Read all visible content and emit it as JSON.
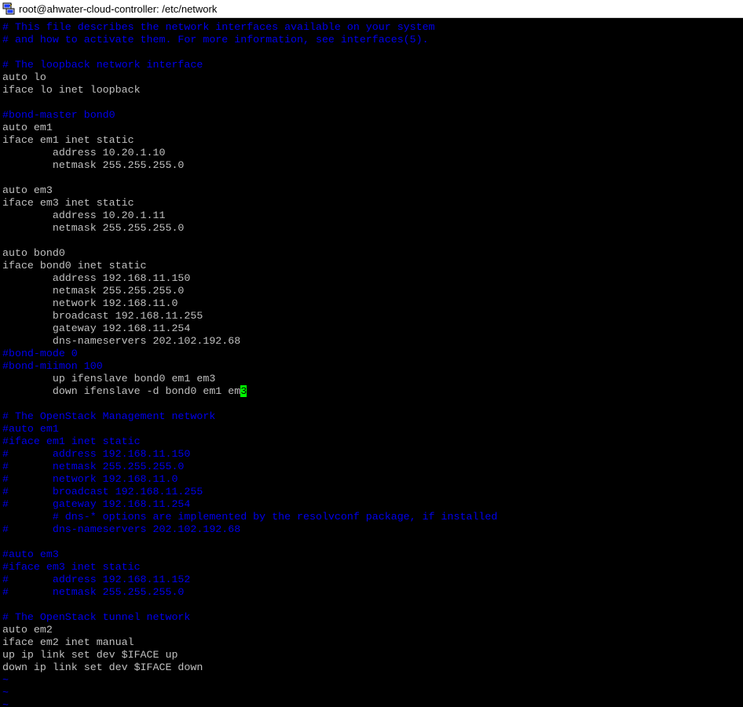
{
  "window": {
    "title": "root@ahwater-cloud-controller: /etc/network"
  },
  "file": {
    "lines": [
      {
        "type": "comment",
        "text": "# This file describes the network interfaces available on your system"
      },
      {
        "type": "comment",
        "text": "# and how to activate them. For more information, see interfaces(5)."
      },
      {
        "type": "blank",
        "text": ""
      },
      {
        "type": "comment",
        "text": "# The loopback network interface"
      },
      {
        "type": "code",
        "text": "auto lo"
      },
      {
        "type": "code",
        "text": "iface lo inet loopback"
      },
      {
        "type": "blank",
        "text": ""
      },
      {
        "type": "comment",
        "text": "#bond-master bond0"
      },
      {
        "type": "code",
        "text": "auto em1"
      },
      {
        "type": "code",
        "text": "iface em1 inet static"
      },
      {
        "type": "code",
        "text": "        address 10.20.1.10"
      },
      {
        "type": "code",
        "text": "        netmask 255.255.255.0"
      },
      {
        "type": "blank",
        "text": ""
      },
      {
        "type": "code",
        "text": "auto em3"
      },
      {
        "type": "code",
        "text": "iface em3 inet static"
      },
      {
        "type": "code",
        "text": "        address 10.20.1.11"
      },
      {
        "type": "code",
        "text": "        netmask 255.255.255.0"
      },
      {
        "type": "blank",
        "text": ""
      },
      {
        "type": "code",
        "text": "auto bond0"
      },
      {
        "type": "code",
        "text": "iface bond0 inet static"
      },
      {
        "type": "code",
        "text": "        address 192.168.11.150"
      },
      {
        "type": "code",
        "text": "        netmask 255.255.255.0"
      },
      {
        "type": "code",
        "text": "        network 192.168.11.0"
      },
      {
        "type": "code",
        "text": "        broadcast 192.168.11.255"
      },
      {
        "type": "code",
        "text": "        gateway 192.168.11.254"
      },
      {
        "type": "code",
        "text": "        dns-nameservers 202.102.192.68"
      },
      {
        "type": "comment",
        "text": "#bond-mode 0"
      },
      {
        "type": "comment",
        "text": "#bond-miimon 100"
      },
      {
        "type": "code",
        "text": "        up ifenslave bond0 em1 em3"
      },
      {
        "type": "cursor",
        "text": "        down ifenslave -d bond0 em1 em",
        "cursor_char": "3"
      },
      {
        "type": "blank",
        "text": ""
      },
      {
        "type": "comment",
        "text": "# The OpenStack Management network"
      },
      {
        "type": "comment",
        "text": "#auto em1"
      },
      {
        "type": "comment",
        "text": "#iface em1 inet static"
      },
      {
        "type": "comment",
        "text": "#       address 192.168.11.150"
      },
      {
        "type": "comment",
        "text": "#       netmask 255.255.255.0"
      },
      {
        "type": "comment",
        "text": "#       network 192.168.11.0"
      },
      {
        "type": "comment",
        "text": "#       broadcast 192.168.11.255"
      },
      {
        "type": "comment",
        "text": "#       gateway 192.168.11.254"
      },
      {
        "type": "comment",
        "text": "        # dns-* options are implemented by the resolvconf package, if installed"
      },
      {
        "type": "comment",
        "text": "#       dns-nameservers 202.102.192.68"
      },
      {
        "type": "blank",
        "text": ""
      },
      {
        "type": "comment",
        "text": "#auto em3"
      },
      {
        "type": "comment",
        "text": "#iface em3 inet static"
      },
      {
        "type": "comment",
        "text": "#       address 192.168.11.152"
      },
      {
        "type": "comment",
        "text": "#       netmask 255.255.255.0"
      },
      {
        "type": "blank",
        "text": ""
      },
      {
        "type": "comment",
        "text": "# The OpenStack tunnel network"
      },
      {
        "type": "code",
        "text": "auto em2"
      },
      {
        "type": "code",
        "text": "iface em2 inet manual"
      },
      {
        "type": "code",
        "text": "up ip link set dev $IFACE up"
      },
      {
        "type": "code",
        "text": "down ip link set dev $IFACE down"
      },
      {
        "type": "tilde",
        "text": "~"
      },
      {
        "type": "tilde",
        "text": "~"
      },
      {
        "type": "tilde",
        "text": "~"
      }
    ]
  },
  "colors": {
    "background": "#000000",
    "text": "#c0c0c0",
    "comment": "#0000ee",
    "cursor": "#00ff00"
  },
  "icons": {
    "app": "putty-icon"
  }
}
